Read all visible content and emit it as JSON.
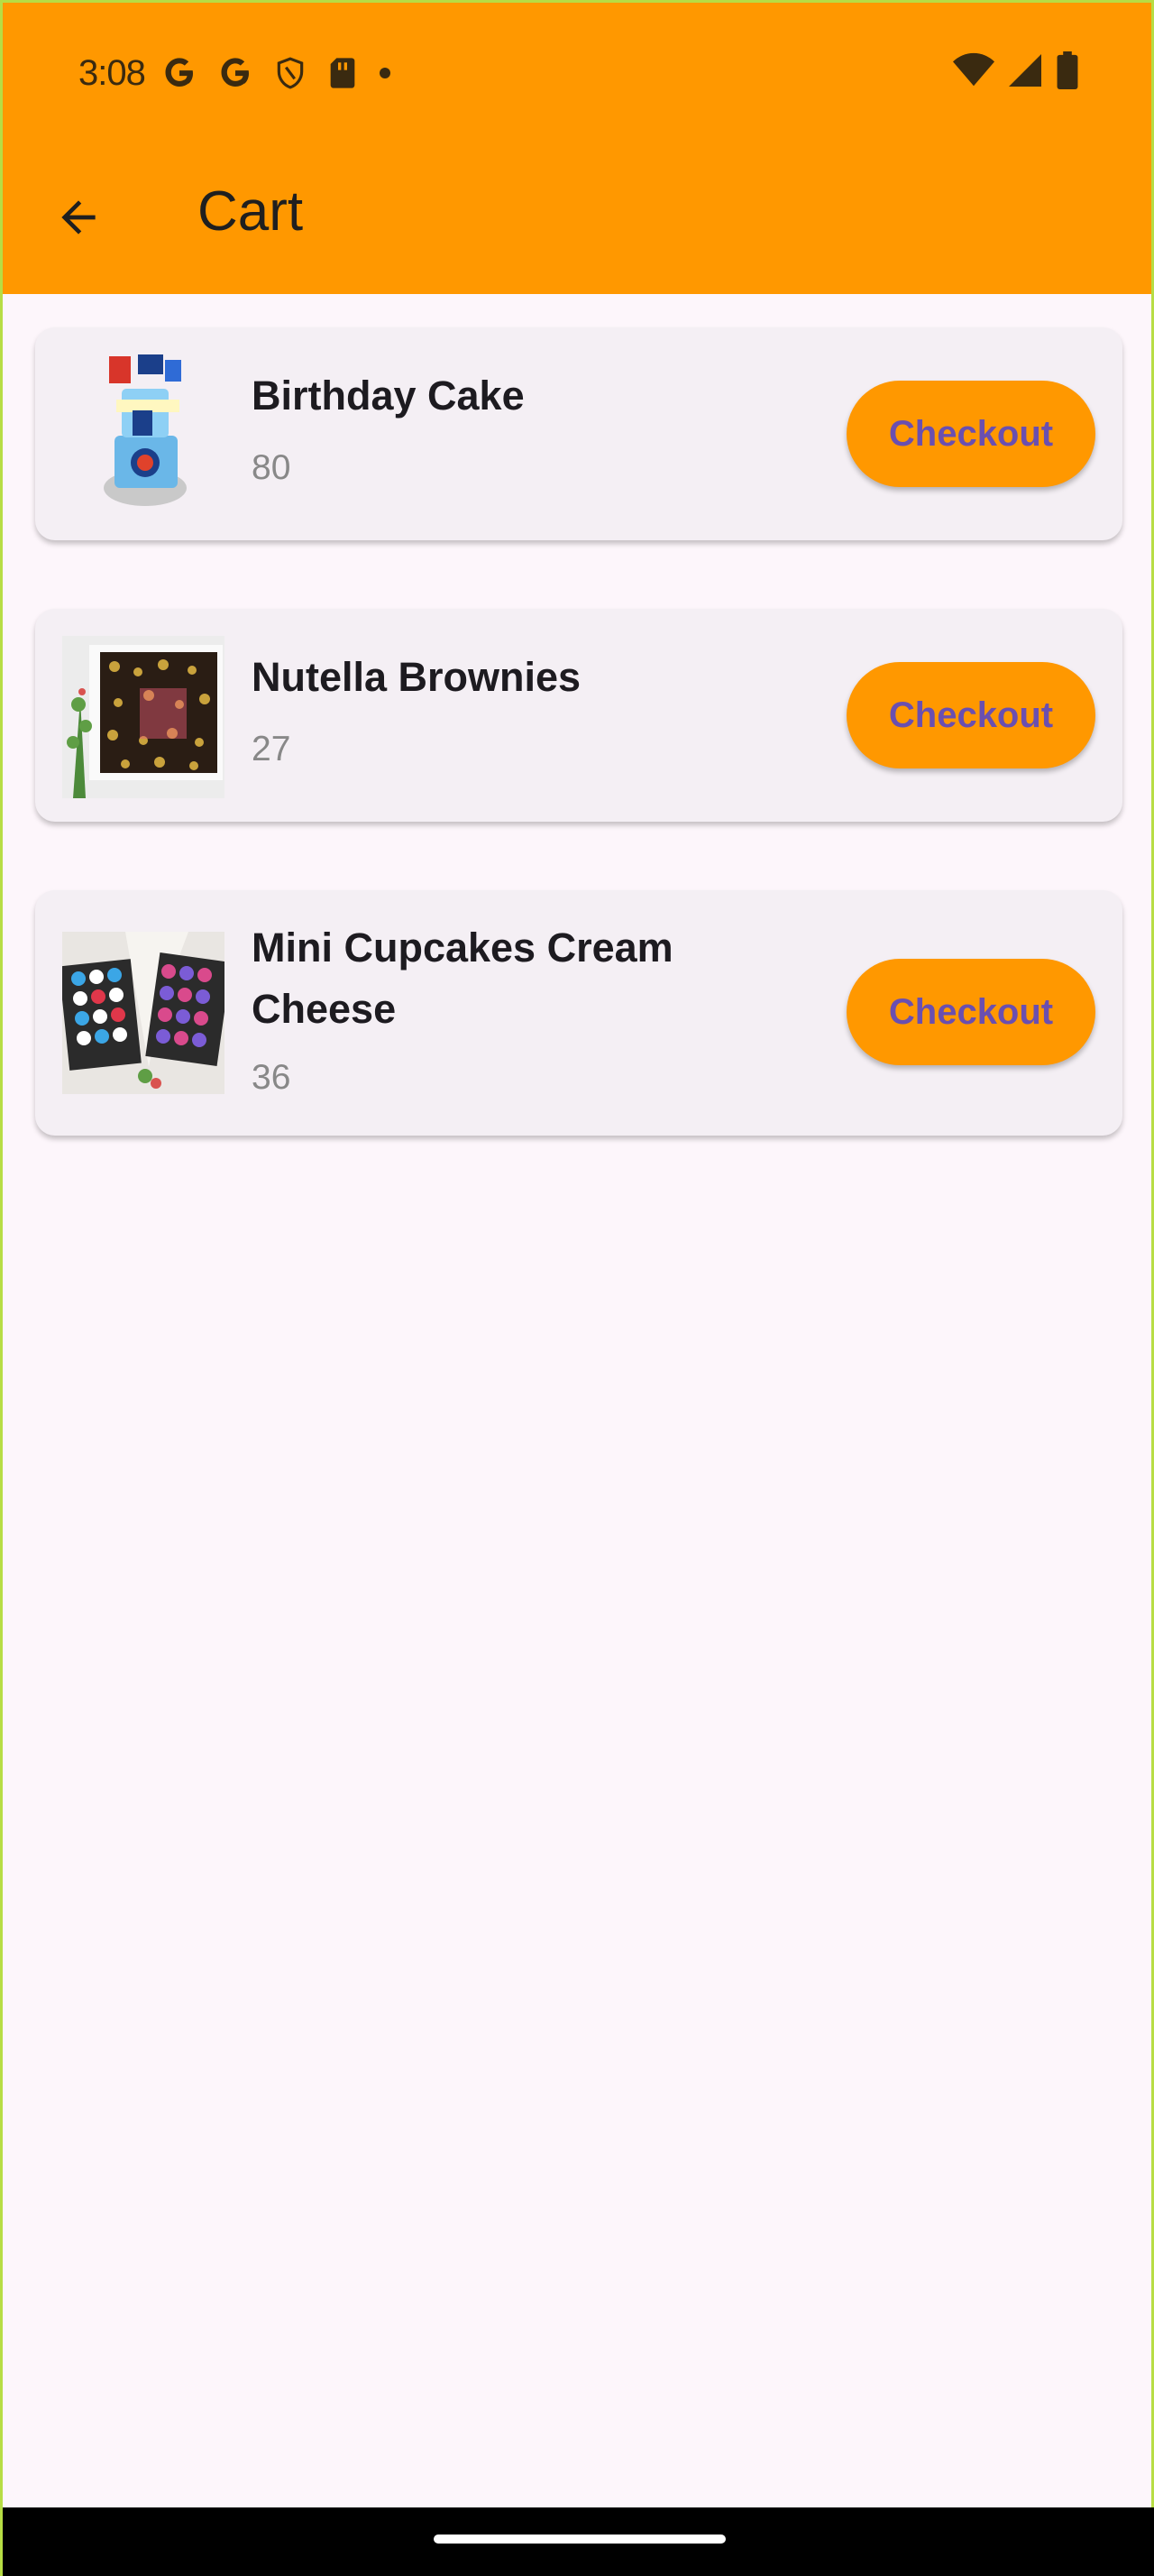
{
  "status_bar": {
    "time": "3:08",
    "left_icons": [
      "google-g-icon",
      "google-g-icon",
      "shield-icon",
      "sd-card-icon",
      "dot-icon"
    ],
    "right_icons": [
      "wifi-icon",
      "cellular-signal-icon",
      "battery-icon"
    ]
  },
  "app_bar": {
    "title": "Cart",
    "back_icon": "arrow-back-icon",
    "color": "#ff9800"
  },
  "cart": {
    "items": [
      {
        "name": "Birthday Cake",
        "price": "80",
        "button": "Checkout",
        "image": "birthday-cake-image"
      },
      {
        "name": "Nutella Brownies",
        "price": "27",
        "button": "Checkout",
        "image": "nutella-brownies-image"
      },
      {
        "name": "Mini Cupcakes Cream Cheese",
        "price": "36",
        "button": "Checkout",
        "image": "mini-cupcakes-image"
      }
    ]
  },
  "colors": {
    "accent": "#ff9800",
    "button_text": "#6a4fb0",
    "background": "#fdf6fb",
    "card": "#f4eff4"
  }
}
